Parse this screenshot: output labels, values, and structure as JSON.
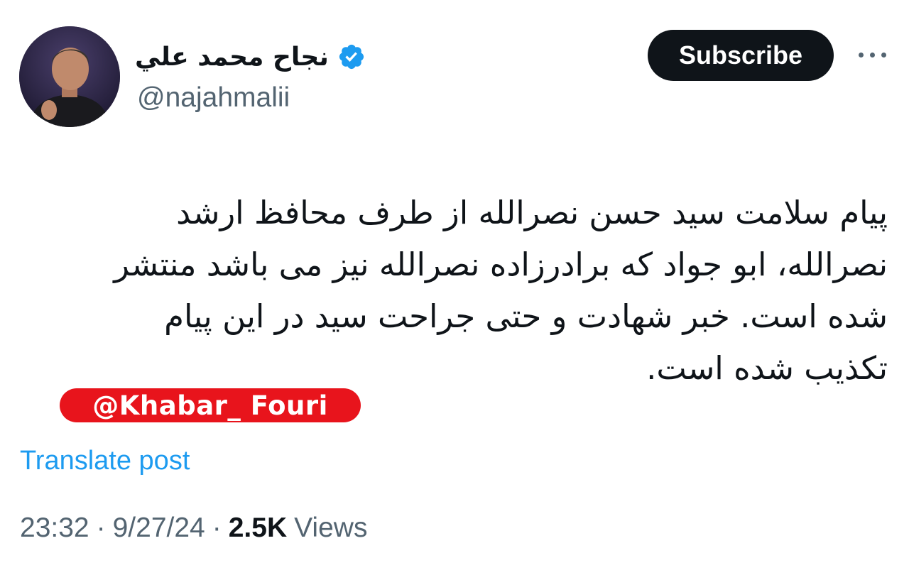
{
  "author": {
    "display_name": "نجاح محمد علي",
    "handle": "@najahmalii",
    "verified": true,
    "avatar_icon": "profile-photo",
    "verified_icon": "verified-badge-icon",
    "verified_color": "#1d9bf0"
  },
  "actions": {
    "subscribe_label": "Subscribe",
    "more_icon": "more-dots-icon"
  },
  "tweet": {
    "lines": [
      "پیام سلامت سید حسن نصرالله از طرف محافظ ارشد",
      "نصرالله، ابو جواد که برادرزاده نصرالله نیز می باشد منتشر",
      "شده است. خبر شهادت و حتی جراحت سید در این پیام",
      "تکذیب شده است."
    ],
    "watermark": "@Khabar_ Fouri",
    "watermark_color": "#e8141c",
    "translate_label": "Translate post"
  },
  "meta": {
    "time": "23:32",
    "separator": "·",
    "date": "9/27/24",
    "views_count": "2.5K",
    "views_label": "Views"
  },
  "colors": {
    "accent": "#1d9bf0",
    "text_primary": "#0f1419",
    "text_secondary": "#536471",
    "button_bg": "#0f1419"
  }
}
